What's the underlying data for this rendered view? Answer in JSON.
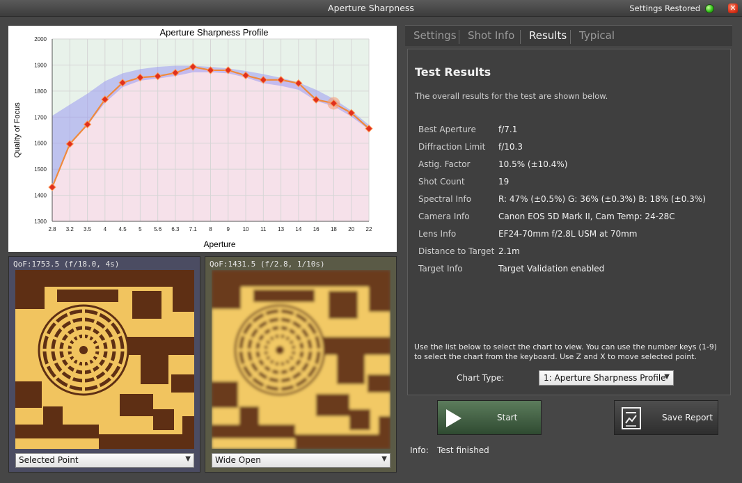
{
  "window": {
    "title": "Aperture Sharpness",
    "status_text": "Settings Restored",
    "status_color": "#33c21a"
  },
  "chart_data": {
    "type": "line",
    "title": "Aperture Sharpness Profile",
    "xlabel": "Aperture",
    "ylabel": "Quality of Focus",
    "categories": [
      "2.8",
      "3.2",
      "3.5",
      "4",
      "4.5",
      "5",
      "5.6",
      "6.3",
      "7.1",
      "8",
      "9",
      "10",
      "11",
      "13",
      "14",
      "16",
      "18",
      "20",
      "22"
    ],
    "ylim": [
      1300,
      2000
    ],
    "yticks": [
      "1300",
      "1400",
      "1500",
      "1600",
      "1700",
      "1800",
      "1900",
      "2000"
    ],
    "grid": true,
    "series": [
      {
        "values": [
          1431,
          1597,
          1672,
          1768,
          1832,
          1852,
          1857,
          1870,
          1893,
          1880,
          1880,
          1860,
          1843,
          1843,
          1830,
          1767,
          1753,
          1716,
          1656
        ],
        "color": "#f08a3c",
        "marker_color": "#e0301e"
      }
    ],
    "band": {
      "upper": [
        1705,
        1748,
        1790,
        1838,
        1868,
        1884,
        1893,
        1897,
        1897,
        1893,
        1887,
        1877,
        1865,
        1851,
        1833,
        1805,
        1770,
        1725,
        1670
      ],
      "lower": [
        1431,
        1597,
        1668,
        1755,
        1815,
        1840,
        1848,
        1858,
        1872,
        1872,
        1868,
        1852,
        1830,
        1820,
        1805,
        1762,
        1742,
        1702,
        1652
      ],
      "color": "#9a9af0"
    },
    "highlight_index": 16,
    "background_colors": {
      "upper": "#e8f2ea",
      "lower": "#f6e1ea"
    }
  },
  "previews": {
    "left": {
      "caption": "QoF:1753.5 (f/18.0, 4s)",
      "select": "Selected Point"
    },
    "right": {
      "caption": "QoF:1431.5 (f/2.8, 1/10s)",
      "select": "Wide Open"
    }
  },
  "tabs": [
    "Settings",
    "Shot Info",
    "Results",
    "Typical"
  ],
  "active_tab": "Results",
  "results": {
    "heading": "Test Results",
    "intro": "The overall results for the test are shown below.",
    "rows": [
      {
        "key": "Best Aperture",
        "value": "f/7.1"
      },
      {
        "key": "Diffraction Limit",
        "value": "f/10.3"
      },
      {
        "key": "Astig. Factor",
        "value": "10.5% (±10.4%)"
      },
      {
        "key": "Shot Count",
        "value": "19"
      },
      {
        "key": "Spectral Info",
        "value": "R: 47% (±0.5%) G: 36% (±0.3%) B: 18% (±0.3%)"
      },
      {
        "key": "Camera Info",
        "value": "Canon EOS 5D Mark II, Cam Temp: 24-28C"
      },
      {
        "key": "Lens Info",
        "value": "EF24-70mm f/2.8L USM at 70mm"
      },
      {
        "key": "Distance to Target",
        "value": "2.1m"
      },
      {
        "key": "Target Info",
        "value": "Target Validation enabled"
      }
    ],
    "help": "Use the list below to select the chart to view.  You can use the number keys (1-9) to select the chart from the keyboard.  Use Z and X to move selected point.",
    "chart_type_label": "Chart Type:",
    "chart_type_value": "1: Aperture Sharpness Profile"
  },
  "buttons": {
    "start": "Start",
    "save_report": "Save Report"
  },
  "info": {
    "label": "Info:",
    "value": "Test finished"
  }
}
